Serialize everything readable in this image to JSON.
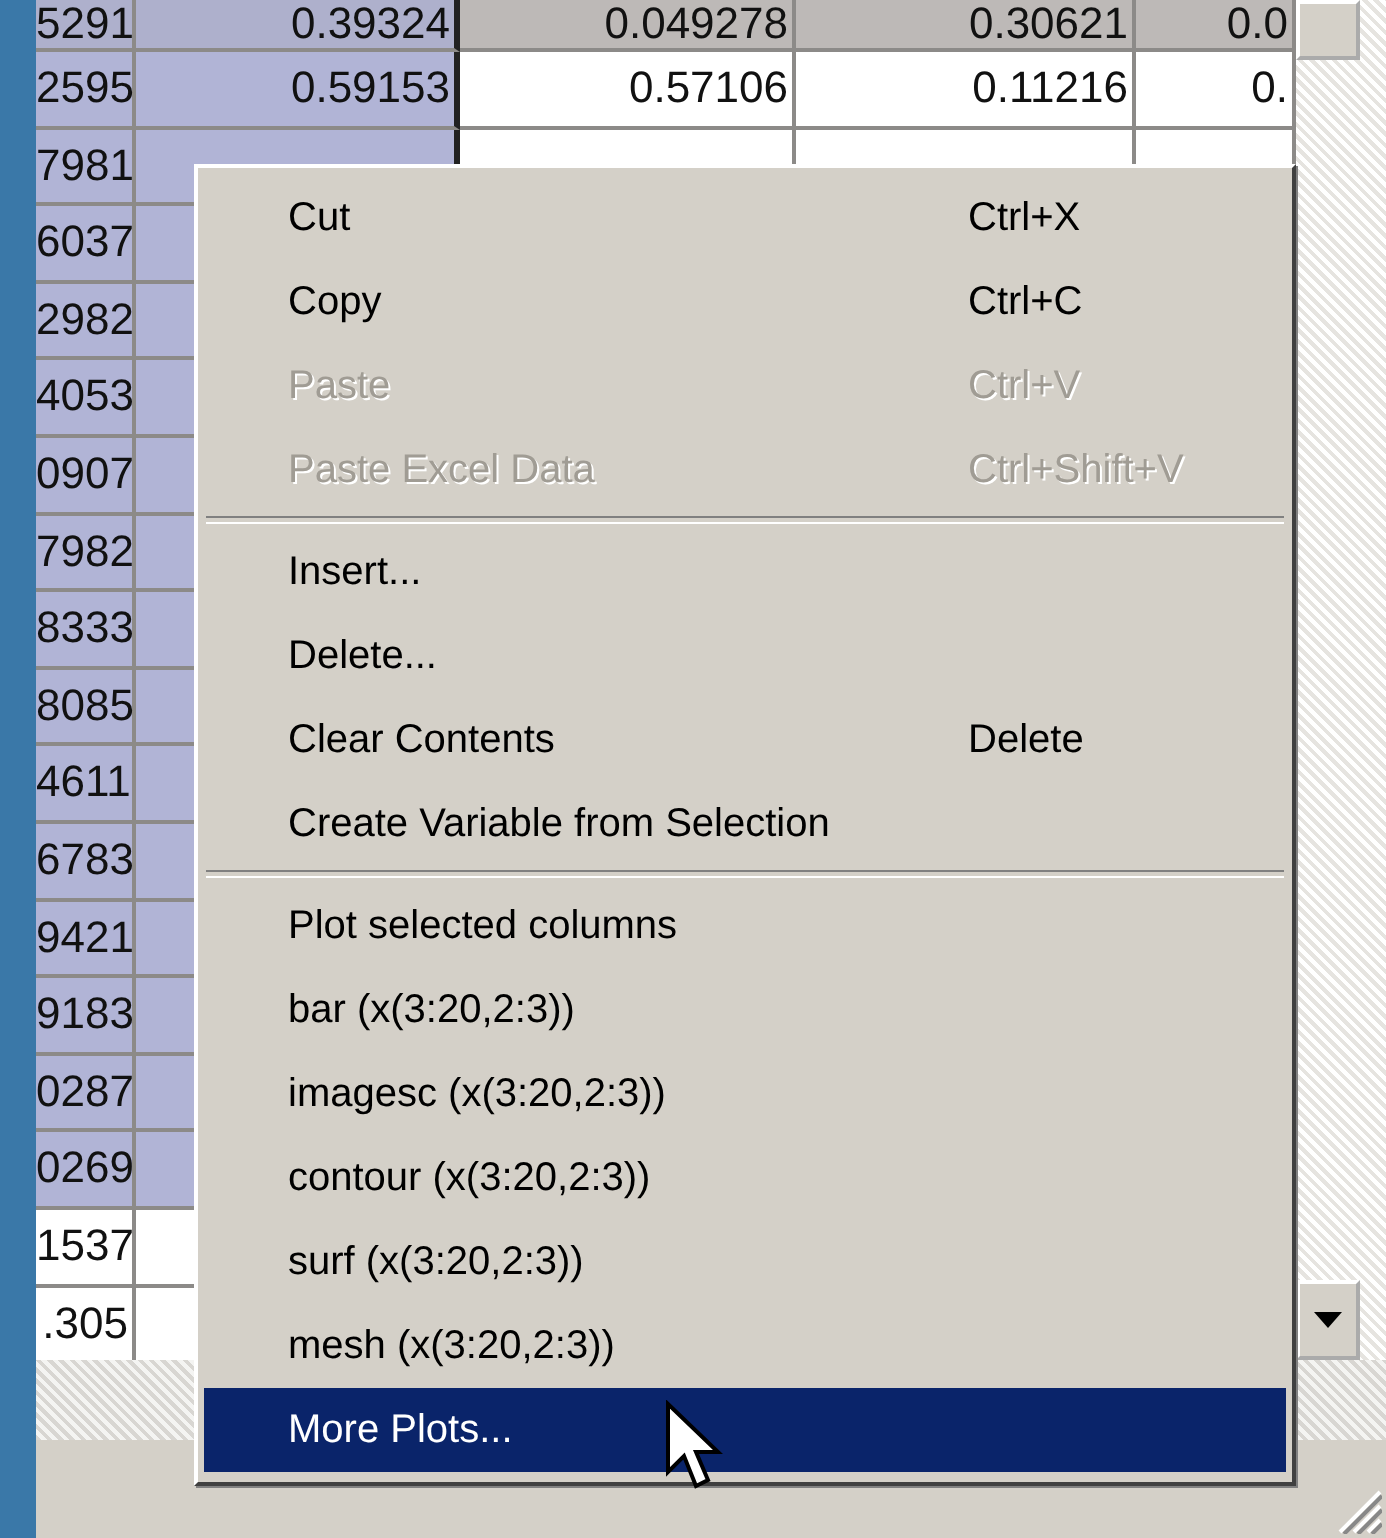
{
  "grid": {
    "rows": [
      {
        "cells": [
          "5291",
          "0.39324",
          "0.049278",
          "0.30621",
          "0.0"
        ],
        "selected": true
      },
      {
        "cells": [
          "2595",
          "0.59153",
          "0.57106",
          "0.11216",
          "0."
        ],
        "selected": true
      },
      {
        "cells": [
          "7981"
        ],
        "selected": true
      },
      {
        "cells": [
          "6037"
        ],
        "selected": true
      },
      {
        "cells": [
          "2982"
        ],
        "selected": true
      },
      {
        "cells": [
          "4053"
        ],
        "selected": true
      },
      {
        "cells": [
          "0907"
        ],
        "selected": true
      },
      {
        "cells": [
          "7982"
        ],
        "selected": true
      },
      {
        "cells": [
          "8333"
        ],
        "selected": true
      },
      {
        "cells": [
          "8085"
        ],
        "selected": true
      },
      {
        "cells": [
          "4611"
        ],
        "selected": true
      },
      {
        "cells": [
          "6783"
        ],
        "selected": true
      },
      {
        "cells": [
          "9421"
        ],
        "selected": true
      },
      {
        "cells": [
          "9183"
        ],
        "selected": true
      },
      {
        "cells": [
          "0287"
        ],
        "selected": true
      },
      {
        "cells": [
          "0269"
        ],
        "selected": true
      },
      {
        "cells": [
          "1537"
        ],
        "selected": false
      },
      {
        "cells": [
          ".305"
        ],
        "selected": false
      }
    ]
  },
  "context_menu": {
    "groups": [
      {
        "items": [
          {
            "label": "Cut",
            "shortcut": "Ctrl+X",
            "disabled": false,
            "selected": false
          },
          {
            "label": "Copy",
            "shortcut": "Ctrl+C",
            "disabled": false,
            "selected": false
          },
          {
            "label": "Paste",
            "shortcut": "Ctrl+V",
            "disabled": true,
            "selected": false
          },
          {
            "label": "Paste Excel Data",
            "shortcut": "Ctrl+Shift+V",
            "disabled": true,
            "selected": false
          }
        ]
      },
      {
        "items": [
          {
            "label": "Insert...",
            "disabled": false,
            "selected": false
          },
          {
            "label": "Delete...",
            "disabled": false,
            "selected": false
          },
          {
            "label": "Clear Contents",
            "shortcut": "Delete",
            "disabled": false,
            "selected": false
          },
          {
            "label": "Create Variable from Selection",
            "disabled": false,
            "selected": false
          }
        ]
      },
      {
        "items": [
          {
            "label": "Plot selected columns",
            "disabled": false,
            "selected": false
          },
          {
            "label": "bar (x(3:20,2:3))",
            "disabled": false,
            "selected": false
          },
          {
            "label": "imagesc (x(3:20,2:3))",
            "disabled": false,
            "selected": false
          },
          {
            "label": "contour (x(3:20,2:3))",
            "disabled": false,
            "selected": false
          },
          {
            "label": "surf (x(3:20,2:3))",
            "disabled": false,
            "selected": false
          },
          {
            "label": "mesh (x(3:20,2:3))",
            "disabled": false,
            "selected": false
          },
          {
            "label": "More Plots...",
            "disabled": false,
            "selected": true
          }
        ]
      }
    ]
  }
}
